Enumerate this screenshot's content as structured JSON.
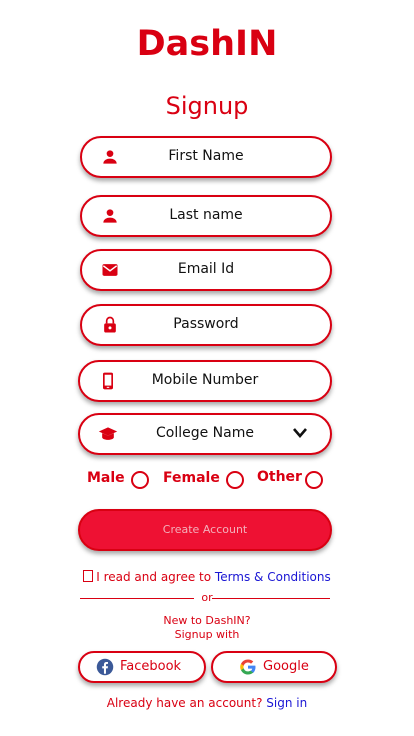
{
  "app": {
    "brand": "DashIN",
    "heading": "Signup"
  },
  "form": {
    "first_name": {
      "placeholder": "First Name",
      "icon": "person-icon"
    },
    "last_name": {
      "placeholder": "Last name",
      "icon": "person-icon"
    },
    "email": {
      "placeholder": "Email Id",
      "icon": "mail-icon"
    },
    "password": {
      "placeholder": "Password",
      "icon": "lock-icon"
    },
    "mobile": {
      "placeholder": "Mobile Number",
      "icon": "phone-icon"
    },
    "college": {
      "selected": "College Name",
      "icon": "graduation-cap-icon"
    }
  },
  "gender": {
    "male": "Male",
    "female": "Female",
    "other": "Other"
  },
  "create_button": "Create Account",
  "terms": {
    "prefix": "I read and agree to ",
    "link": "Terms & Conditions"
  },
  "or": "or",
  "signup_prompt": {
    "line1": "New to DashIN?",
    "line2": "Signup with"
  },
  "social": {
    "facebook": "Facebook",
    "google": "Google"
  },
  "footer": {
    "prefix": "Already have an account? ",
    "link": "Sign in"
  },
  "colors": {
    "accent": "#d90012",
    "button": "#ee1133",
    "link": "#1a16d4"
  }
}
